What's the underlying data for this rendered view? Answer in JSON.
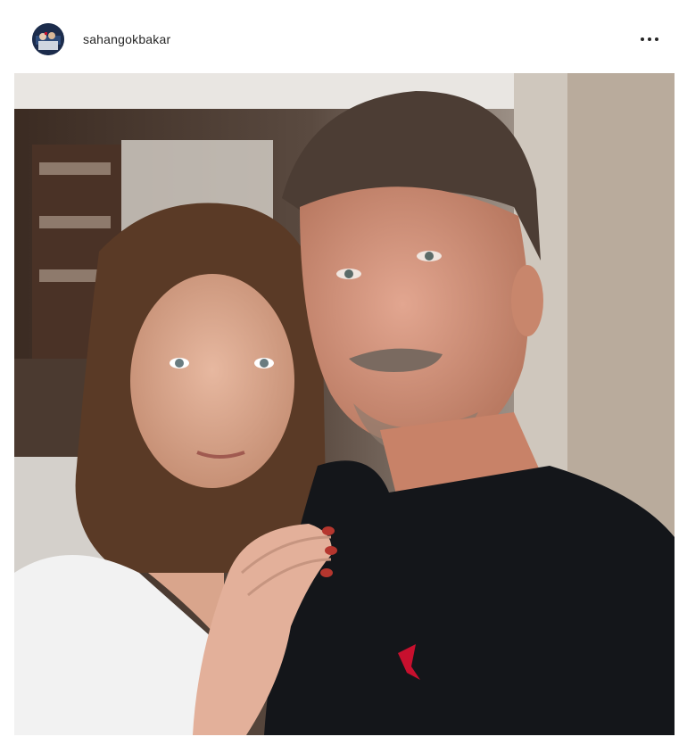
{
  "post": {
    "username": "sahangokbakar",
    "avatar_icon": "user-avatar-icon",
    "more_icon": "more-horizontal-icon",
    "photo_description_icon": "photo"
  },
  "colors": {
    "username_text": "#262626",
    "background": "#ffffff",
    "shirt": "#14161a",
    "logo_red": "#c8102e"
  }
}
